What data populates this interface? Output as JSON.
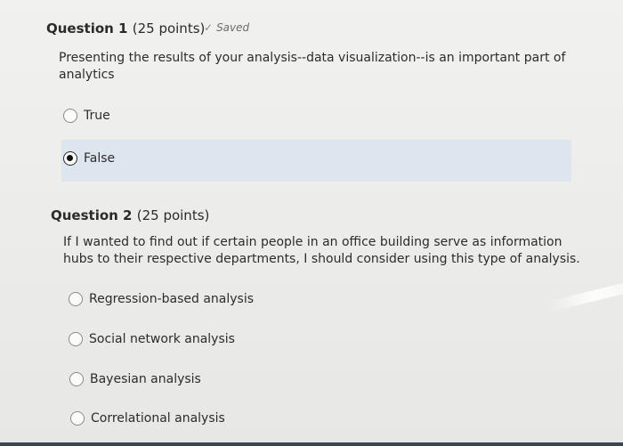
{
  "questions": [
    {
      "title": "Question 1",
      "points": "(25 points)",
      "status": "Saved",
      "prompt_line1": "Presenting the results of your analysis--data visualization--is an important part of",
      "prompt_line2": "analytics",
      "options": [
        {
          "label": "True",
          "selected": false
        },
        {
          "label": "False",
          "selected": true
        }
      ]
    },
    {
      "title": "Question 2",
      "points": "(25 points)",
      "prompt_line1": "If I wanted to find out if certain people in an office building serve as information",
      "prompt_line2": "hubs to their respective departments, I should consider using this type of analysis.",
      "options": [
        {
          "label": "Regression-based analysis",
          "selected": false
        },
        {
          "label": "Social network analysis",
          "selected": false
        },
        {
          "label": "Bayesian analysis",
          "selected": false
        },
        {
          "label": "Correlational analysis",
          "selected": false
        }
      ]
    }
  ],
  "colors": {
    "selected_highlight": "#dde5ee",
    "text": "#2c2c2c"
  }
}
